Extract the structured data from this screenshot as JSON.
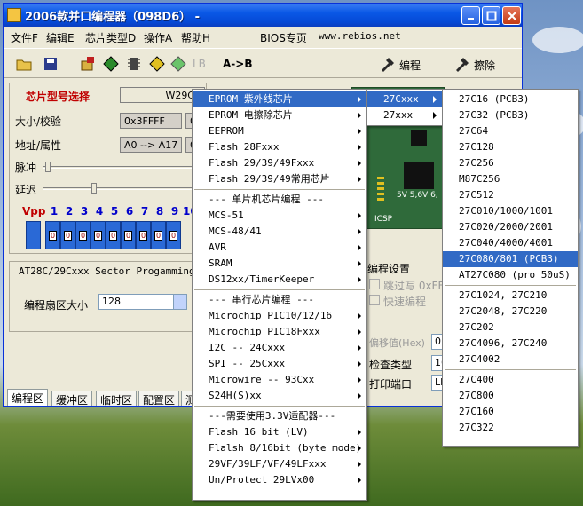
{
  "window": {
    "title": "2006款并口编程器（098D6） -"
  },
  "menubar": [
    "文件F",
    "编辑E",
    "芯片类型D",
    "操作A",
    "帮助H",
    "BIOS专页",
    "www.rebios.net"
  ],
  "toolbar": {
    "ab_label": "A->B",
    "lb_label": "LB",
    "program_label": "编程",
    "erase_label": "擦除"
  },
  "chip_panel": {
    "title": "芯片型号选择",
    "chip_name": "W29C0",
    "size_label": "大小/校验",
    "size_value": "0x3FFFF",
    "size_value2": "0",
    "addr_label": "地址/属性",
    "addr_value": "A0 --> A17",
    "addr_value2": "0",
    "pulse_label": "脉冲",
    "delay_label": "延迟",
    "vpp_label": "Vpp",
    "pins": [
      "1",
      "2",
      "3",
      "4",
      "5",
      "6",
      "7",
      "8",
      "9",
      "10"
    ]
  },
  "sector": {
    "title": "AT28C/29Cxxx Sector Progamming",
    "size_label": "编程扇区大小",
    "size_value": "128"
  },
  "tabs": [
    "编程区",
    "缓冲区",
    "临时区",
    "配置区",
    "测"
  ],
  "board": {
    "label_5v": "5V 5,6V 6,",
    "label_icsp": "ICSP"
  },
  "prog_settings": {
    "title": "编程设置",
    "skip_write": "跳过写 0xFF",
    "fast_program": "快速编程",
    "offset_label": "偏移值(Hex)",
    "offset_value": "0",
    "check_type_label": "检查类型",
    "check_type_value": "16",
    "print_port_label": "打印端口",
    "print_port_value": "LP"
  },
  "menu1": {
    "items": [
      {
        "label": "EPROM 紫外线芯片",
        "sub": true,
        "highlight": true
      },
      {
        "label": "EPROM 电擦除芯片",
        "sub": true
      },
      {
        "label": "EEPROM",
        "sub": true
      },
      {
        "label": "Flash 28Fxxx",
        "sub": true
      },
      {
        "label": "Flash 29/39/49Fxxx",
        "sub": true
      },
      {
        "label": "Flash 29/39/49常用芯片",
        "sub": true
      },
      {
        "sep": "--- 单片机芯片编程 ---"
      },
      {
        "label": "MCS-51",
        "sub": true
      },
      {
        "label": "MCS-48/41",
        "sub": true
      },
      {
        "label": "AVR",
        "sub": true
      },
      {
        "label": "SRAM",
        "sub": true
      },
      {
        "label": "DS12xx/TimerKeeper",
        "sub": true
      },
      {
        "sep": "--- 串行芯片编程 ---"
      },
      {
        "label": "Microchip PIC10/12/16",
        "sub": true
      },
      {
        "label": "Microchip PIC18Fxxx",
        "sub": true
      },
      {
        "label": "I2C -- 24Cxxx",
        "sub": true
      },
      {
        "label": "SPI -- 25Cxxx",
        "sub": true
      },
      {
        "label": "Microwire -- 93Cxx",
        "sub": true
      },
      {
        "label": "S24H(S)xx",
        "sub": true
      },
      {
        "sep": "---需要使用3.3V适配器---"
      },
      {
        "label": "Flash 16 bit (LV)",
        "sub": true
      },
      {
        "label": "Flalsh 8/16bit (byte mode)",
        "sub": true
      },
      {
        "label": "29VF/39LF/VF/49LFxxx",
        "sub": true
      },
      {
        "label": "Un/Protect 29LVx00",
        "sub": true
      }
    ]
  },
  "menu2": {
    "items": [
      {
        "label": "27Cxxx",
        "highlight": true
      },
      {
        "label": "27xxx"
      }
    ]
  },
  "menu3": {
    "items": [
      "27C16   (PCB3)",
      "27C32   (PCB3)",
      "27C64",
      "27C128",
      "27C256",
      "M87C256",
      "27C512",
      "27C010/1000/1001",
      "27C020/2000/2001",
      "27C040/4000/4001",
      "27C080/801    (PCB3)",
      "AT27C080 (pro 50uS)",
      "27C1024, 27C210",
      "27C2048, 27C220",
      "27C202",
      "27C4096, 27C240",
      "27C4002",
      "27C400",
      "27C800",
      "27C160",
      "27C322"
    ],
    "highlight_index": 10
  }
}
